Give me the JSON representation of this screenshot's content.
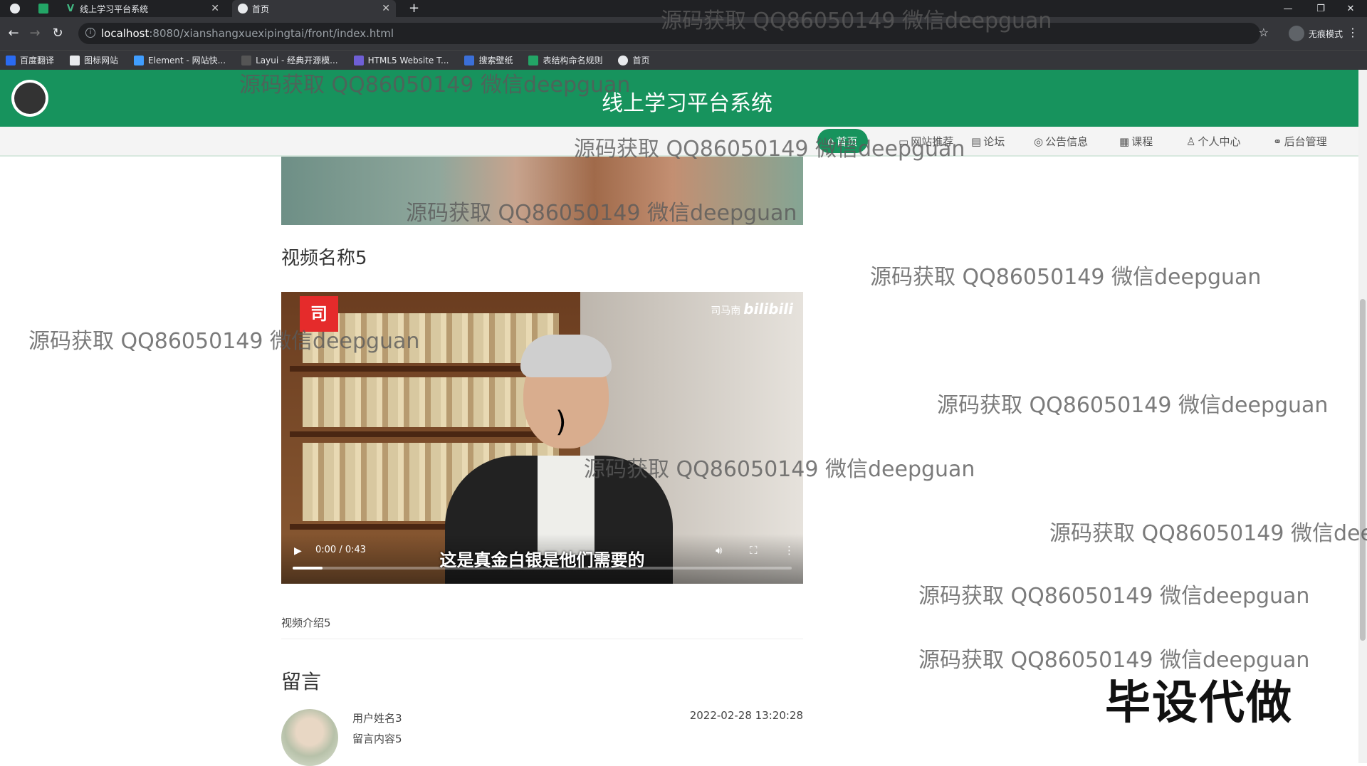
{
  "browser": {
    "tabs": [
      {
        "label": "线上学习平台系统",
        "active": false
      },
      {
        "label": "首页",
        "active": true
      }
    ],
    "url_host": "localhost",
    "url_path": ":8080/xianshangxuexipingtai/front/index.html",
    "profile_label": "无痕模式",
    "bookmarks": [
      "百度翻译",
      "图标网站",
      "Element - 网站快...",
      "Layui - 经典开源模...",
      "HTML5 Website T...",
      "搜索壁纸",
      "表结构命名规则",
      "首页"
    ]
  },
  "site": {
    "title": "线上学习平台系统",
    "nav": [
      {
        "label": "首页",
        "active": true
      },
      {
        "label": "网站推荐",
        "active": false
      },
      {
        "label": "论坛",
        "active": false
      },
      {
        "label": "公告信息",
        "active": false
      },
      {
        "label": "课程",
        "active": false
      },
      {
        "label": "个人中心",
        "active": false
      },
      {
        "label": "后台管理",
        "active": false
      }
    ]
  },
  "video": {
    "name": "视频名称5",
    "badge": "司",
    "channel": "司马南",
    "platform": "bilibili",
    "subtitle": "这是真金白银是他们需要的",
    "time": "0:00 / 0:43",
    "progress": 0.06,
    "description": "视频介绍5"
  },
  "comments": {
    "title": "留言",
    "items": [
      {
        "user": "用户姓名3",
        "content": "留言内容5",
        "time": "2022-02-28 13:20:28"
      }
    ]
  },
  "watermark": "源码获取 QQ86050149 微信deepguan",
  "stamp": "毕设代做",
  "colors": {
    "header_green": "#17935d",
    "chrome_dark": "#202124"
  }
}
